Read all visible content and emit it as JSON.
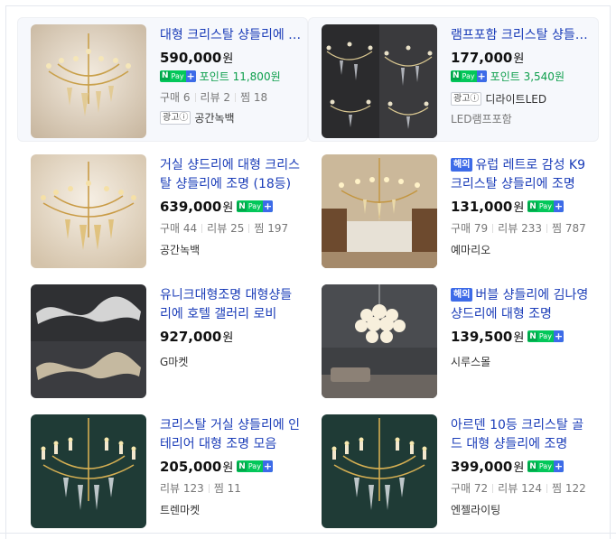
{
  "products": [
    {
      "title": "대형 크리스탈 샹들리에 조명",
      "price": "590,000",
      "won": "원",
      "npay": true,
      "point": "포인트 11,800원",
      "stats": [
        "구매 6",
        "리뷰 2",
        "찜 18"
      ],
      "shop": "공간녹백",
      "ad": true,
      "ad_label": "광고ⓘ",
      "thumb_icon": "chandelier-image"
    },
    {
      "title": "램프포함 크리스탈 샹들리에",
      "price": "177,000",
      "won": "원",
      "npay": true,
      "point": "포인트 3,540원",
      "shop_line": "디라이트LED",
      "shop": "LED램프포함",
      "ad": true,
      "ad_label": "광고ⓘ",
      "thumb_icon": "chandelier-collage-image"
    },
    {
      "title": "거실 샹드리에 대형 크리스탈 샹들리에 조명 (18등)",
      "price": "639,000",
      "won": "원",
      "npay": true,
      "stats": [
        "구매 44",
        "리뷰 25",
        "찜 197"
      ],
      "shop": "공간녹백",
      "thumb_icon": "chandelier-image"
    },
    {
      "tag": "해외",
      "title": "유럽 레트로 감성 K9 크리스탈 샹들리에 조명",
      "price": "131,000",
      "won": "원",
      "npay": true,
      "stats": [
        "구매 79",
        "리뷰 233",
        "찜 787"
      ],
      "shop": "예마리오",
      "thumb_icon": "living-room-chandelier-image"
    },
    {
      "title": "유니크대형조명 대형샹들리에 호텔 갤러리 로비",
      "price": "927,000",
      "won": "원",
      "npay": false,
      "shop": "G마켓",
      "thumb_icon": "wave-lamp-image"
    },
    {
      "tag": "해외",
      "title": "버블 샹들리에 김나영 샹드리에 대형 조명",
      "price": "139,500",
      "won": "원",
      "npay": true,
      "shop": "시루스몰",
      "thumb_icon": "bubble-lamp-image"
    },
    {
      "title": "크리스탈 거실 샹들리에 인테리어 대형 조명 모음",
      "price": "205,000",
      "won": "원",
      "npay": true,
      "stats": [
        "리뷰 123",
        "찜 11"
      ],
      "shop": "트렌마켓",
      "thumb_icon": "gold-chandelier-image"
    },
    {
      "title": "아르덴 10등 크리스탈 골드 대형 샹들리에 조명",
      "price": "399,000",
      "won": "원",
      "npay": true,
      "stats": [
        "구매 72",
        "리뷰 124",
        "찜 122"
      ],
      "shop": "엔젤라이팅",
      "thumb_icon": "gold-chandelier-image"
    }
  ],
  "npay_label": {
    "n": "N",
    "pay": "Pay",
    "plus": "+"
  },
  "colors": {
    "title_link": "#1a3cb8",
    "point_green": "#0c9e4b",
    "npay_green": "#03c75a",
    "tag_blue": "#3d6be8"
  }
}
